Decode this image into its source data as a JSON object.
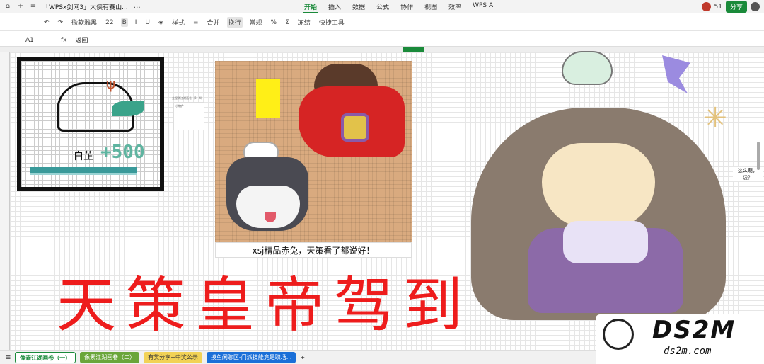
{
  "window": {
    "doc_title": "「WPSx剑网3」大侠有赛山...",
    "menus": [
      "开始",
      "插入",
      "数据",
      "公式",
      "协作",
      "视图",
      "效率",
      "WPS AI"
    ],
    "active_menu": "开始",
    "share_label": "分享",
    "collab_count": "51"
  },
  "toolbar": {
    "font_name": "微软雅黑",
    "font_size": "22",
    "style_label": "样式",
    "merge_label": "合并",
    "wrap_label": "换行",
    "number_format": "常规",
    "freeze_label": "冻结",
    "quick_tools_label": "快捷工具",
    "bold": "B",
    "italic": "I",
    "underline": "U"
  },
  "formula_bar": {
    "cell_ref": "A1",
    "fx": "fx",
    "value": "返回"
  },
  "art1": {
    "label": "白芷",
    "amount": "+500"
  },
  "thumb": {
    "caption": "金涅华江湖画卷（3 · 4）",
    "text": "小物件"
  },
  "art2": {
    "caption": "xsj精品赤兔，天策看了都说好！"
  },
  "banner": {
    "text": "天策皇帝驾到"
  },
  "side_note": "这么萌，\n袋？",
  "watermark": {
    "title": "DS2M",
    "url": "ds2m.com"
  },
  "sheet_tabs": [
    {
      "label": "像素江湖画卷（一）",
      "style": "a"
    },
    {
      "label": "像素江湖画卷（二）",
      "style": "g"
    },
    {
      "label": "有奖分享+中奖公示",
      "style": "y"
    },
    {
      "label": "摸鱼闲聊区-门派技能竟是职场...",
      "style": "b"
    }
  ],
  "colors": {
    "accent": "#1a8a3a",
    "banner_red": "#ee1111",
    "horse_red": "#d62424",
    "teal": "#3a9a9a"
  }
}
